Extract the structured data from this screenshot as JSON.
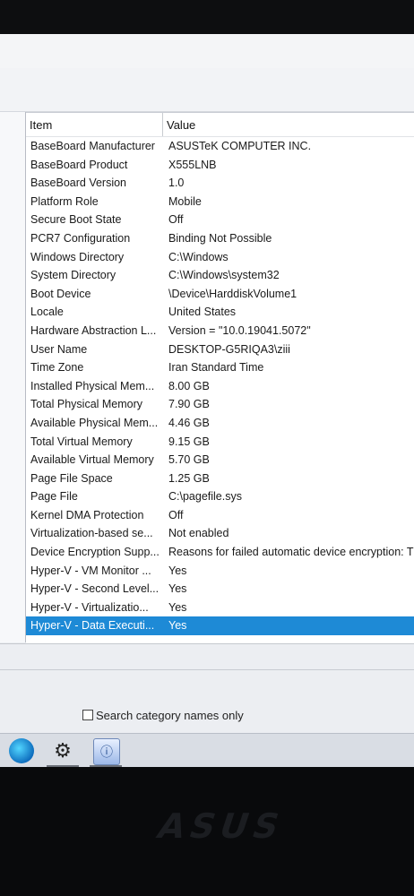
{
  "list": {
    "header_item": "Item",
    "header_value": "Value",
    "rows": [
      {
        "item": "BaseBoard Manufacturer",
        "value": "ASUSTeK COMPUTER INC."
      },
      {
        "item": "BaseBoard Product",
        "value": "X555LNB"
      },
      {
        "item": "BaseBoard Version",
        "value": "1.0"
      },
      {
        "item": "Platform Role",
        "value": "Mobile"
      },
      {
        "item": "Secure Boot State",
        "value": "Off"
      },
      {
        "item": "PCR7 Configuration",
        "value": "Binding Not Possible"
      },
      {
        "item": "Windows Directory",
        "value": "C:\\Windows"
      },
      {
        "item": "System Directory",
        "value": "C:\\Windows\\system32"
      },
      {
        "item": "Boot Device",
        "value": "\\Device\\HarddiskVolume1"
      },
      {
        "item": "Locale",
        "value": "United States"
      },
      {
        "item": "Hardware Abstraction L...",
        "value": "Version = \"10.0.19041.5072\""
      },
      {
        "item": "User Name",
        "value": "DESKTOP-G5RIQA3\\ziii"
      },
      {
        "item": "Time Zone",
        "value": "Iran Standard Time"
      },
      {
        "item": "Installed Physical Mem...",
        "value": "8.00 GB"
      },
      {
        "item": "Total Physical Memory",
        "value": "7.90 GB"
      },
      {
        "item": "Available Physical Mem...",
        "value": "4.46 GB"
      },
      {
        "item": "Total Virtual Memory",
        "value": "9.15 GB"
      },
      {
        "item": "Available Virtual Memory",
        "value": "5.70 GB"
      },
      {
        "item": "Page File Space",
        "value": "1.25 GB"
      },
      {
        "item": "Page File",
        "value": "C:\\pagefile.sys"
      },
      {
        "item": "Kernel DMA Protection",
        "value": "Off"
      },
      {
        "item": "Virtualization-based se...",
        "value": "Not enabled"
      },
      {
        "item": "Device Encryption Supp...",
        "value": "Reasons for failed automatic device encryption: TP"
      },
      {
        "item": "Hyper-V - VM Monitor ...",
        "value": "Yes"
      },
      {
        "item": "Hyper-V - Second Level...",
        "value": "Yes"
      },
      {
        "item": "Hyper-V - Virtualizatio...",
        "value": "Yes"
      },
      {
        "item": "Hyper-V - Data Executi...",
        "value": "Yes"
      }
    ]
  },
  "search": {
    "category_names_only_label": "Search category names only"
  },
  "taskbar": {
    "icons": [
      "edge-icon",
      "settings-icon",
      "system-information-icon"
    ]
  },
  "brand": {
    "logo_text": "ASUS"
  }
}
